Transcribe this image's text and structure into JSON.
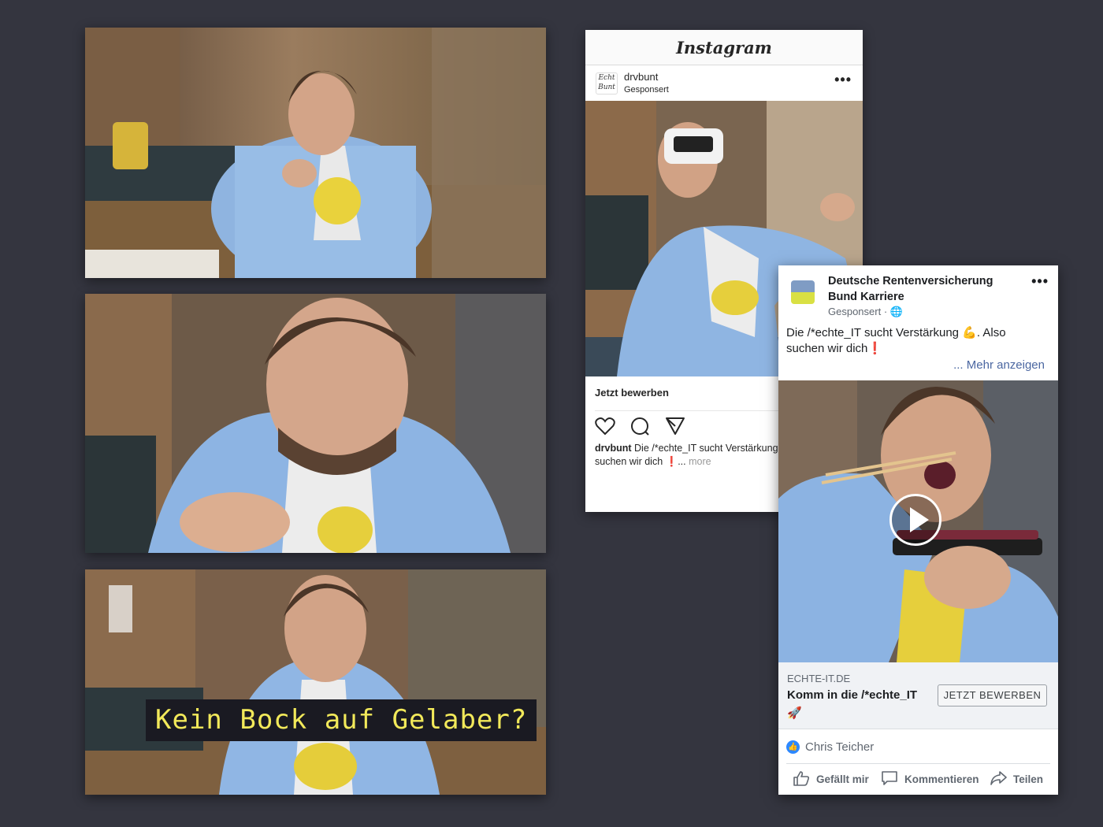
{
  "frames": [
    {
      "subtitle": ""
    },
    {
      "subtitle": ""
    },
    {
      "subtitle": "Kein Bock auf Gelaber?"
    }
  ],
  "instagram": {
    "logo": "Instagram",
    "avatar_text": "Echt Bunt",
    "username": "drvbunt",
    "sponsored": "Gesponsert",
    "menu": "•••",
    "cta": "Jetzt bewerben",
    "caption_user": "drvbunt",
    "caption_text": "Die /*echte_IT sucht Verstärkung",
    "caption_line2": "suchen wir dich ❗...",
    "more": "more",
    "icons": [
      "heart-icon",
      "comment-icon",
      "send-icon"
    ]
  },
  "facebook": {
    "page_name": "Deutsche Rentenversicherung Bund Karriere",
    "sponsored": "Gesponsert · 🌐",
    "menu": "•••",
    "post_text": "Die /*echte_IT sucht Verstärkung 💪. Also suchen wir dich❗",
    "more_link": "... Mehr anzeigen",
    "domain": "ECHTE-IT.DE",
    "headline": "Komm in die /*echte_IT",
    "headline_emoji": "🚀",
    "cta_button": "JETZT BEWERBEN",
    "reactor": "Chris Teicher",
    "actions": {
      "like": "Gefällt mir",
      "comment": "Kommentieren",
      "share": "Teilen"
    },
    "colors": {
      "logo_top": "#7f9cc4",
      "logo_bottom": "#d9e043",
      "link": "#4b67a1"
    }
  }
}
